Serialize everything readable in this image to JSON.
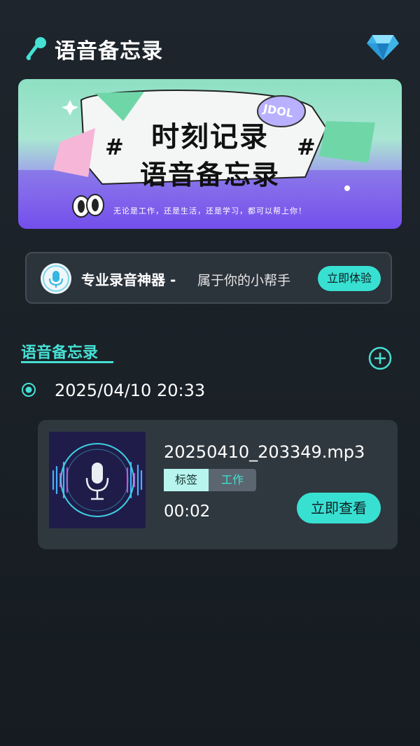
{
  "header": {
    "title": "语音备忘录",
    "app_icon": "mic-person-icon",
    "vip_icon": "diamond-icon"
  },
  "banner": {
    "line1": "时刻记录",
    "line2": "语音备忘录",
    "badge": "JDOL",
    "hash_symbol": "#",
    "subtitle": "无论是工作，还是生活，还是学习，都可以帮上你！"
  },
  "promo": {
    "icon": "microphone-icon",
    "title": "专业录音神器 -",
    "subtitle": "属于你的小帮手",
    "button_label": "立即体验"
  },
  "section": {
    "title": "语音备忘录",
    "add_icon": "plus-circle-icon"
  },
  "entries": [
    {
      "date": "2025/04/10 20:33",
      "file_name": "20250410_203349.mp3",
      "tag_label": "标签",
      "tag_value": "工作",
      "duration": "00:02",
      "button_label": "立即查看"
    }
  ],
  "colors": {
    "accent": "#38e0d2",
    "background": "#1e252c",
    "card": "#2f383f"
  }
}
